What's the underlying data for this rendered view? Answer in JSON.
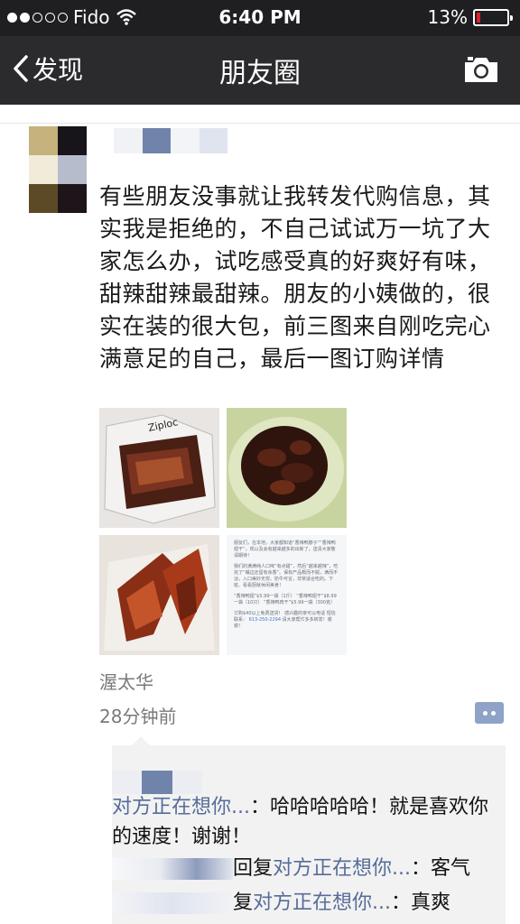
{
  "status_bar": {
    "carrier": "Fido",
    "time": "6:40 PM",
    "battery_percent": "13%",
    "battery_level": 0.13,
    "signal_bars_filled": 2,
    "signal_bars_total": 5
  },
  "nav": {
    "back_label": "发现",
    "title": "朋友圈"
  },
  "post": {
    "text": "有些朋友没事就让我转发代购信息，其实我是拒绝的，不自己试试万一坑了大家怎么办，试吃感受真的好爽好有味，甜辣甜辣最甜辣。朋友的小姨做的，很实在装的很大包，前三图来自刚吃完心满意足的自己，最后一图订购详情",
    "location": "渥太华",
    "time_ago": "28分钟前",
    "photo_icons": [
      "snack-bag-photo",
      "spicy-wings-plate-photo",
      "braised-duck-photo",
      "order-info-screenshot"
    ],
    "order_info": {
      "para1": "朋友们，在本地，大家都知道“香辣鸭脖子”“香辣鸭翅干”，现以及会有越来越多的出新了，送清大家敬请期待！",
      "para2": "我们的满满纯人口味“有点甜”，然后“越来越辣”，吃完了“嘴边还留有余香”。保有产品概而不腻，满而不淡，入口美妙无穷。奶牛可言，非常适合吃的。下班、看看厨就休闲美食！",
      "prices": "“香辣鸭翅”$5.99一袋（1斤） “香辣鸭翅干”$8.99一袋（10只） “香辣鸭肉干”$5.99一袋（300克）",
      "contact": "订购$40以上免费送货！ 感兴趣的亲可以电话 短信联系：",
      "phone": "613-250-2294",
      "closing": "请大家帮忙多多转发！谢谢！"
    }
  },
  "comments": [
    {
      "name": "对方正在想你...",
      "text": "：哈哈哈哈哈！就是喜欢你的速度！谢谢！"
    },
    {
      "reply_prefix": "回复",
      "name": "对方正在想你...",
      "text": "：客气"
    },
    {
      "reply_prefix": "复",
      "name": "对方正在想你...",
      "text": "：真爽"
    }
  ],
  "colors": {
    "status_bg": "#1f1f21",
    "nav_bg": "#2b2b2e",
    "link_blue": "#566c9a",
    "comment_bg": "#f2f2f2",
    "battery_red": "#e0212b"
  }
}
